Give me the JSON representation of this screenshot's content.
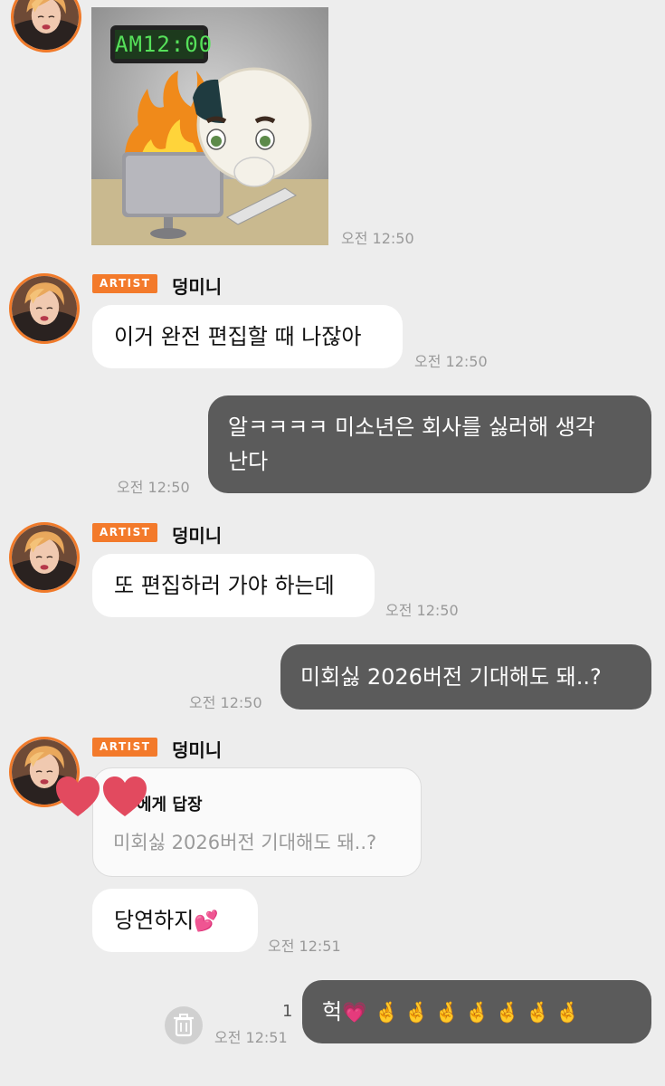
{
  "sticker_message": {
    "clock_text": "AM12:00",
    "time": "오전 12:50"
  },
  "artist": {
    "badge": "ARTIST",
    "name": "덩미니"
  },
  "messages": [
    {
      "from": "artist",
      "text": "이거 완전 편집할 때 나잖아",
      "time": "오전 12:50"
    },
    {
      "from": "me",
      "lines": [
        "알ㅋㅋㅋㅋ 미소년은 회사를 싫러해 생각",
        "난다"
      ],
      "time": "오전 12:50"
    },
    {
      "from": "artist",
      "text": "또 편집하러 가야 하는데",
      "time": "오전 12:50"
    },
    {
      "from": "me",
      "text": "미회싫 2026버전 기대해도 돼..?",
      "time": "오전 12:50"
    },
    {
      "from": "artist",
      "reply_label": "에게 답장",
      "reply_quote": "미회싫 2026버전 기대해도 돼..?"
    },
    {
      "from": "artist",
      "text": "당연하지",
      "emoji": "💕",
      "time": "오전 12:51"
    },
    {
      "from": "me",
      "text": "헉",
      "emoji": "💗",
      "hands": "🤞🤞🤞🤞🤞🤞🤞",
      "time": "오전 12:51",
      "unread": "1"
    }
  ],
  "colors": {
    "accent": "#f37a2b",
    "out_bubble": "#5b5b5b",
    "in_bubble": "#ffffff",
    "background": "#ededed"
  },
  "icons": {
    "delete": "trash-icon",
    "hearts": "heart-icon"
  }
}
